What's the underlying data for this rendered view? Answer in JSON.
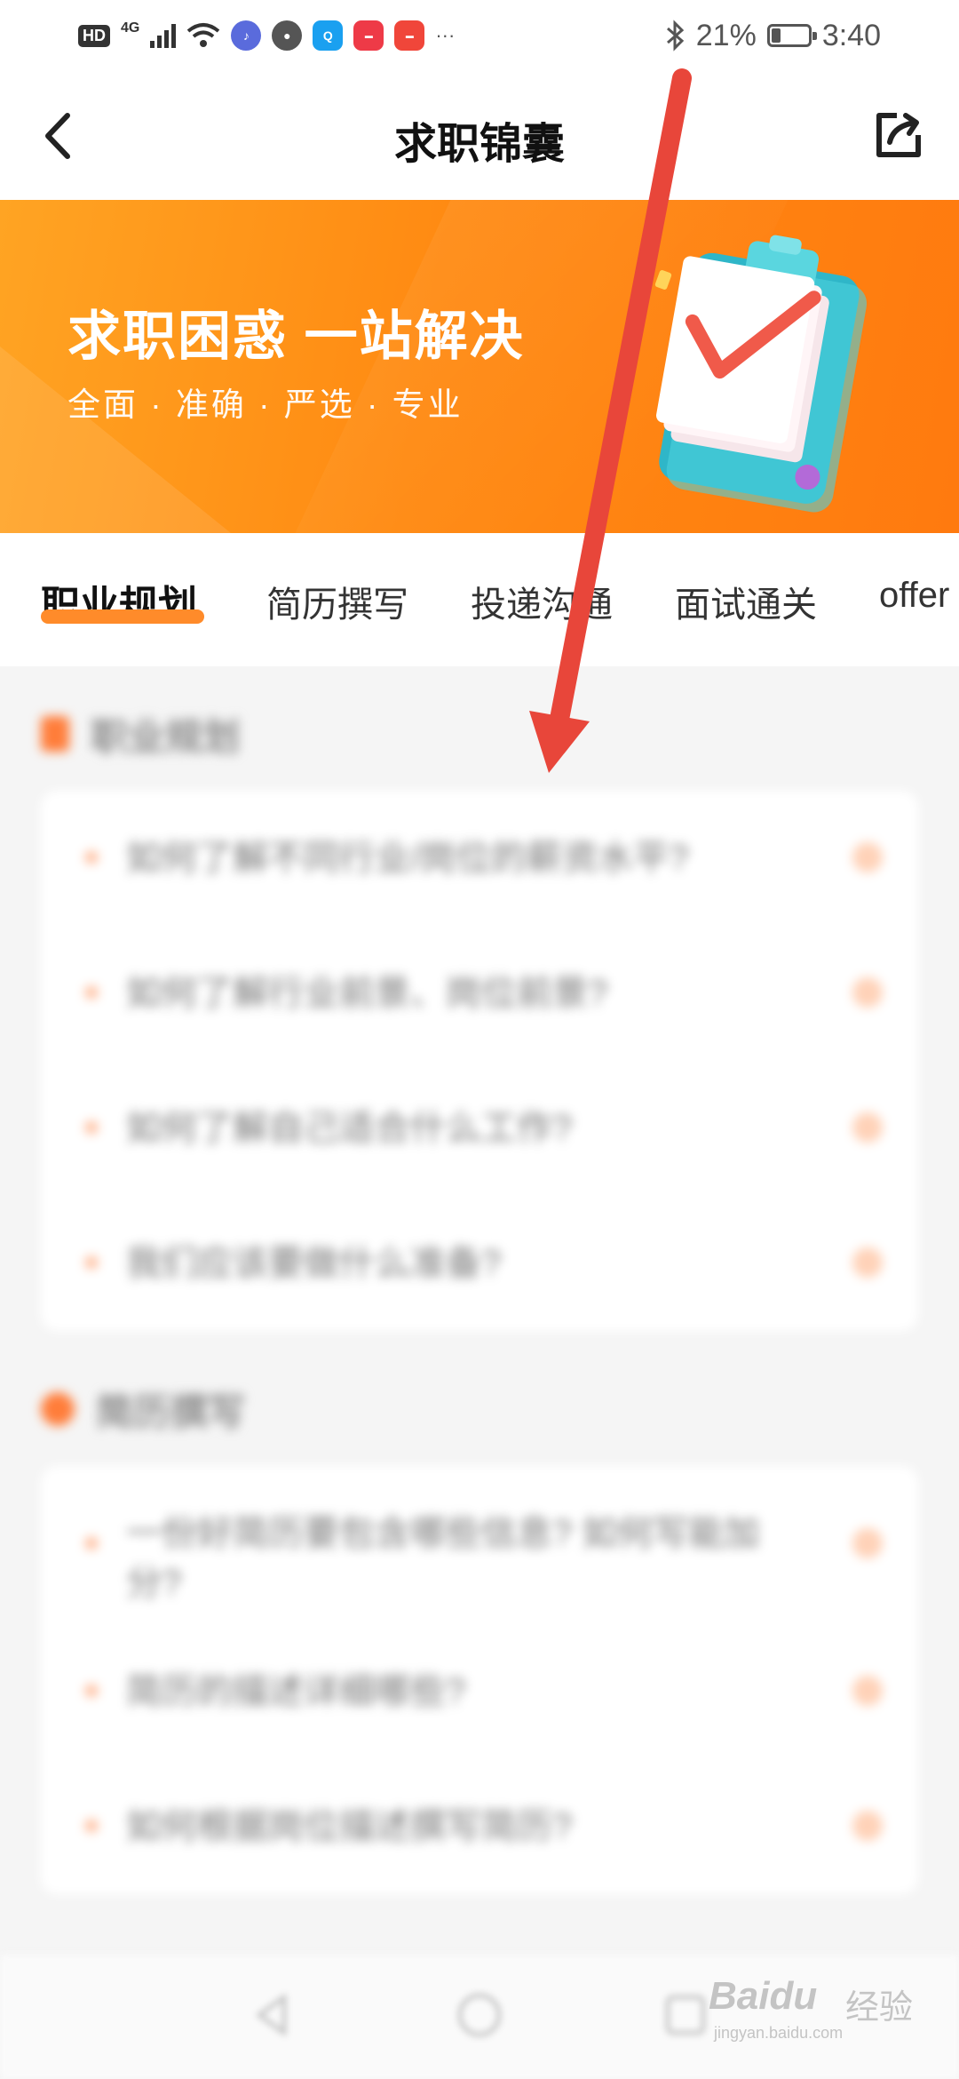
{
  "status_bar": {
    "hd": "HD",
    "network": "4G",
    "battery": "21%",
    "time": "3:40",
    "battery_level": 0.21,
    "app_icons": [
      "music-app-icon",
      "messages-app-icon",
      "search-app-icon",
      "huawei-app-icon",
      "huawei-store-icon"
    ],
    "more": "···"
  },
  "header": {
    "title": "求职锦囊",
    "back_icon": "chevron-left-icon",
    "share_icon": "share-icon"
  },
  "banner": {
    "title": "求职困惑 一站解决",
    "subtitle": "全面 · 准确 · 严选 · 专业",
    "colors": {
      "from": "#ffa423",
      "to": "#ff7a0f"
    }
  },
  "tabs": [
    {
      "label": "职业规划",
      "active": true
    },
    {
      "label": "简历撰写",
      "active": false
    },
    {
      "label": "投递沟通",
      "active": false
    },
    {
      "label": "面试通关",
      "active": false
    },
    {
      "label": "offer",
      "active": false
    }
  ],
  "sections": [
    {
      "title": "职业规划",
      "questions": [
        "如何了解不同行业/岗位的薪资水平?",
        "如何了解行业前景、岗位前景?",
        "如何了解自己适合什么工作?",
        "我们应该要做什么准备?"
      ]
    },
    {
      "title": "简历撰写",
      "questions": [
        "一份好简历要包含哪些信息? 如何写能加分?",
        "简历的描述详细哪些?",
        "如何根据岗位描述撰写简历?"
      ]
    }
  ],
  "watermark": {
    "brand": "Baidu",
    "suffix": "经验",
    "url": "jingyan.baidu.com"
  },
  "accent_color": "#ff8b2a",
  "annotation_color": "#e8463a"
}
